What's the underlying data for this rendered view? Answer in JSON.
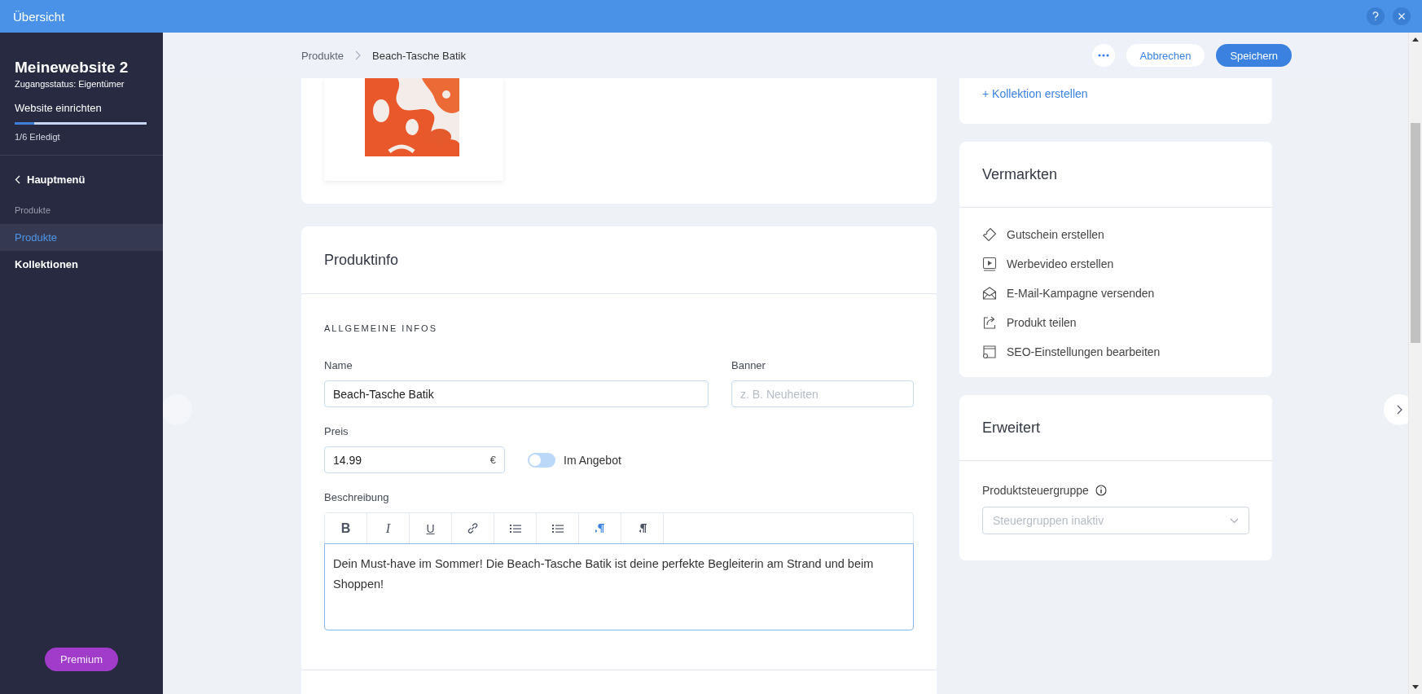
{
  "topbar": {
    "title": "Übersicht"
  },
  "sidebar": {
    "site_name": "Meinewebsite 2",
    "access": "Zugangsstatus: Eigentümer",
    "setup": {
      "label": "Website einrichten",
      "level": 0.15,
      "status": "1/6 Erledigt"
    },
    "back": "Hauptmenü",
    "section": "Produkte",
    "items": [
      {
        "label": "Produkte",
        "selected": true
      },
      {
        "label": "Kollektionen",
        "selected": false
      }
    ],
    "premium": "Premium"
  },
  "header": {
    "breadcrumb": [
      "Produkte",
      "Beach-Tasche Batik"
    ],
    "buttons": [
      {
        "kind": "more"
      },
      {
        "kind": "secondary",
        "label": "Abbrechen"
      },
      {
        "kind": "primary",
        "label": "Speichern"
      }
    ]
  },
  "produktinfo": {
    "title": "Produktinfo",
    "section": "ALLGEMEINE INFOS",
    "name": {
      "label": "Name",
      "value": "Beach-Tasche Batik"
    },
    "banner": {
      "label": "Banner",
      "placeholder": "z. B. Neuheiten"
    },
    "price": {
      "label": "Preis",
      "value": "14.99",
      "currency": "€"
    },
    "sale": {
      "label": "Im Angebot",
      "on": false
    },
    "description": {
      "label": "Beschreibung",
      "toolbar": [
        {
          "kind": "bold",
          "label": "B",
          "selected": false
        },
        {
          "kind": "italic",
          "label": "I",
          "selected": false
        },
        {
          "kind": "underline",
          "label": "U",
          "selected": false
        },
        {
          "kind": "link",
          "selected": false
        },
        {
          "kind": "bullets",
          "selected": false
        },
        {
          "kind": "numbers",
          "selected": false
        },
        {
          "kind": "ltr",
          "selected": true
        },
        {
          "kind": "rtl",
          "selected": false
        }
      ],
      "value": "Dein Must-have im Sommer! Die Beach-Tasche Batik ist deine perfekte Begleiterin am Strand und beim Shoppen!"
    }
  },
  "collections": {
    "create_link": "+ Kollektion erstellen"
  },
  "marketing": {
    "title": "Vermarkten",
    "actions": [
      {
        "kind": "coupon",
        "label": "Gutschein erstellen"
      },
      {
        "kind": "video",
        "label": "Werbevideo erstellen"
      },
      {
        "kind": "email",
        "label": "E-Mail-Kampagne versenden"
      },
      {
        "kind": "share",
        "label": "Produkt teilen"
      },
      {
        "kind": "seo",
        "label": "SEO-Einstellungen bearbeiten"
      }
    ]
  },
  "advanced": {
    "title": "Erweitert",
    "tax_label": "Produktsteuergruppe",
    "tax_select": {
      "placeholder": "Steuergruppen inaktiv"
    }
  }
}
